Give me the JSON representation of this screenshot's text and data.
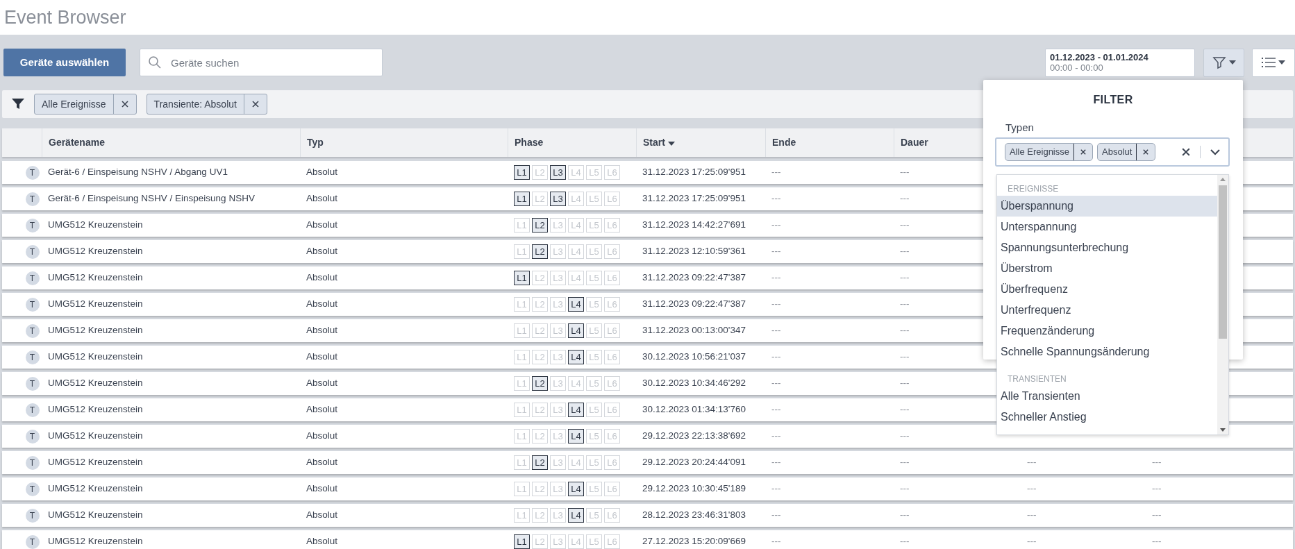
{
  "title": "Event Browser",
  "toolbar": {
    "select_button": "Geräte auswählen",
    "search": {
      "placeholder": "Geräte suchen"
    },
    "date_range": {
      "dates": "01.12.2023 - 01.01.2024",
      "times": "00:00 - 00:00"
    },
    "filter_open": true
  },
  "active_filters": [
    "Alle Ereignisse",
    "Transiente: Absolut"
  ],
  "table": {
    "columns": [
      {
        "label": "Gerätename",
        "sorted": false
      },
      {
        "label": "Typ",
        "sorted": false
      },
      {
        "label": "Phase",
        "sorted": false
      },
      {
        "label": "Start",
        "sorted": true
      },
      {
        "label": "Ende",
        "sorted": false
      },
      {
        "label": "Dauer",
        "sorted": false
      }
    ],
    "rows": [
      {
        "badge": "T",
        "name": "Gerät-6 / Einspeisung NSHV / Abgang UV1",
        "type": "Absolut",
        "phases": [
          {
            "label": "L1",
            "active": true
          },
          {
            "label": "L2",
            "active": false
          },
          {
            "label": "L3",
            "active": true
          },
          {
            "label": "L4",
            "active": false
          },
          {
            "label": "L5",
            "active": false
          },
          {
            "label": "L6",
            "active": false
          }
        ],
        "start": "31.12.2023 17:25:09'951",
        "end": "---",
        "duration": "---"
      },
      {
        "badge": "T",
        "name": "Gerät-6 / Einspeisung NSHV / Einspeisung NSHV",
        "type": "Absolut",
        "phases": [
          {
            "label": "L1",
            "active": true
          },
          {
            "label": "L2",
            "active": false
          },
          {
            "label": "L3",
            "active": true
          },
          {
            "label": "L4",
            "active": false
          },
          {
            "label": "L5",
            "active": false
          },
          {
            "label": "L6",
            "active": false
          }
        ],
        "start": "31.12.2023 17:25:09'951",
        "end": "---",
        "duration": "---"
      },
      {
        "badge": "T",
        "name": "UMG512 Kreuzenstein",
        "type": "Absolut",
        "phases": [
          {
            "label": "L1",
            "active": false
          },
          {
            "label": "L2",
            "active": true
          },
          {
            "label": "L3",
            "active": false
          },
          {
            "label": "L4",
            "active": false
          },
          {
            "label": "L5",
            "active": false
          },
          {
            "label": "L6",
            "active": false
          }
        ],
        "start": "31.12.2023 14:42:27'691",
        "end": "---",
        "duration": "---"
      },
      {
        "badge": "T",
        "name": "UMG512 Kreuzenstein",
        "type": "Absolut",
        "phases": [
          {
            "label": "L1",
            "active": false
          },
          {
            "label": "L2",
            "active": true
          },
          {
            "label": "L3",
            "active": false
          },
          {
            "label": "L4",
            "active": false
          },
          {
            "label": "L5",
            "active": false
          },
          {
            "label": "L6",
            "active": false
          }
        ],
        "start": "31.12.2023 12:10:59'361",
        "end": "---",
        "duration": "---"
      },
      {
        "badge": "T",
        "name": "UMG512 Kreuzenstein",
        "type": "Absolut",
        "phases": [
          {
            "label": "L1",
            "active": true
          },
          {
            "label": "L2",
            "active": false
          },
          {
            "label": "L3",
            "active": false
          },
          {
            "label": "L4",
            "active": false
          },
          {
            "label": "L5",
            "active": false
          },
          {
            "label": "L6",
            "active": false
          }
        ],
        "start": "31.12.2023 09:22:47'387",
        "end": "---",
        "duration": "---"
      },
      {
        "badge": "T",
        "name": "UMG512 Kreuzenstein",
        "type": "Absolut",
        "phases": [
          {
            "label": "L1",
            "active": false
          },
          {
            "label": "L2",
            "active": false
          },
          {
            "label": "L3",
            "active": false
          },
          {
            "label": "L4",
            "active": true
          },
          {
            "label": "L5",
            "active": false
          },
          {
            "label": "L6",
            "active": false
          }
        ],
        "start": "31.12.2023 09:22:47'387",
        "end": "---",
        "duration": "---"
      },
      {
        "badge": "T",
        "name": "UMG512 Kreuzenstein",
        "type": "Absolut",
        "phases": [
          {
            "label": "L1",
            "active": false
          },
          {
            "label": "L2",
            "active": false
          },
          {
            "label": "L3",
            "active": false
          },
          {
            "label": "L4",
            "active": true
          },
          {
            "label": "L5",
            "active": false
          },
          {
            "label": "L6",
            "active": false
          }
        ],
        "start": "31.12.2023 00:13:00'347",
        "end": "---",
        "duration": "---"
      },
      {
        "badge": "T",
        "name": "UMG512 Kreuzenstein",
        "type": "Absolut",
        "phases": [
          {
            "label": "L1",
            "active": false
          },
          {
            "label": "L2",
            "active": false
          },
          {
            "label": "L3",
            "active": false
          },
          {
            "label": "L4",
            "active": true
          },
          {
            "label": "L5",
            "active": false
          },
          {
            "label": "L6",
            "active": false
          }
        ],
        "start": "30.12.2023 10:56:21'037",
        "end": "---",
        "duration": "---"
      },
      {
        "badge": "T",
        "name": "UMG512 Kreuzenstein",
        "type": "Absolut",
        "phases": [
          {
            "label": "L1",
            "active": false
          },
          {
            "label": "L2",
            "active": true
          },
          {
            "label": "L3",
            "active": false
          },
          {
            "label": "L4",
            "active": false
          },
          {
            "label": "L5",
            "active": false
          },
          {
            "label": "L6",
            "active": false
          }
        ],
        "start": "30.12.2023 10:34:46'292",
        "end": "---",
        "duration": "---"
      },
      {
        "badge": "T",
        "name": "UMG512 Kreuzenstein",
        "type": "Absolut",
        "phases": [
          {
            "label": "L1",
            "active": false
          },
          {
            "label": "L2",
            "active": false
          },
          {
            "label": "L3",
            "active": false
          },
          {
            "label": "L4",
            "active": true
          },
          {
            "label": "L5",
            "active": false
          },
          {
            "label": "L6",
            "active": false
          }
        ],
        "start": "30.12.2023 01:34:13'760",
        "end": "---",
        "duration": "---"
      },
      {
        "badge": "T",
        "name": "UMG512 Kreuzenstein",
        "type": "Absolut",
        "phases": [
          {
            "label": "L1",
            "active": false
          },
          {
            "label": "L2",
            "active": false
          },
          {
            "label": "L3",
            "active": false
          },
          {
            "label": "L4",
            "active": true
          },
          {
            "label": "L5",
            "active": false
          },
          {
            "label": "L6",
            "active": false
          }
        ],
        "start": "29.12.2023 22:13:38'692",
        "end": "---",
        "duration": "---"
      },
      {
        "badge": "T",
        "name": "UMG512 Kreuzenstein",
        "type": "Absolut",
        "phases": [
          {
            "label": "L1",
            "active": false
          },
          {
            "label": "L2",
            "active": true
          },
          {
            "label": "L3",
            "active": false
          },
          {
            "label": "L4",
            "active": false
          },
          {
            "label": "L5",
            "active": false
          },
          {
            "label": "L6",
            "active": false
          }
        ],
        "start": "29.12.2023 20:24:44'091",
        "end": "---",
        "duration": "---",
        "column_7": "---",
        "column_8": "---"
      },
      {
        "badge": "T",
        "name": "UMG512 Kreuzenstein",
        "type": "Absolut",
        "phases": [
          {
            "label": "L1",
            "active": false
          },
          {
            "label": "L2",
            "active": false
          },
          {
            "label": "L3",
            "active": false
          },
          {
            "label": "L4",
            "active": true
          },
          {
            "label": "L5",
            "active": false
          },
          {
            "label": "L6",
            "active": false
          }
        ],
        "start": "29.12.2023 10:30:45'189",
        "end": "---",
        "duration": "---",
        "column_7": "---",
        "column_8": "---"
      },
      {
        "badge": "T",
        "name": "UMG512 Kreuzenstein",
        "type": "Absolut",
        "phases": [
          {
            "label": "L1",
            "active": false
          },
          {
            "label": "L2",
            "active": false
          },
          {
            "label": "L3",
            "active": false
          },
          {
            "label": "L4",
            "active": true
          },
          {
            "label": "L5",
            "active": false
          },
          {
            "label": "L6",
            "active": false
          }
        ],
        "start": "28.12.2023 23:46:31'803",
        "end": "---",
        "duration": "---",
        "column_7": "---",
        "column_8": "---"
      },
      {
        "badge": "T",
        "name": "UMG512 Kreuzenstein",
        "type": "Absolut",
        "phases": [
          {
            "label": "L1",
            "active": true
          },
          {
            "label": "L2",
            "active": false
          },
          {
            "label": "L3",
            "active": false
          },
          {
            "label": "L4",
            "active": false
          },
          {
            "label": "L5",
            "active": false
          },
          {
            "label": "L6",
            "active": false
          }
        ],
        "start": "27.12.2023 15:20:09'669",
        "end": "---",
        "duration": "---",
        "column_7": "---",
        "column_8": "---"
      }
    ]
  },
  "filter_panel": {
    "title": "FILTER",
    "label": "Typen",
    "chips": [
      "Alle Ereignisse",
      "Absolut"
    ],
    "groups": [
      {
        "heading": "EREIGNISSE",
        "items": [
          {
            "label": "Überspannung",
            "highlighted": true
          },
          {
            "label": "Unterspannung",
            "highlighted": false
          },
          {
            "label": "Spannungsunterbrechung",
            "highlighted": false
          },
          {
            "label": "Überstrom",
            "highlighted": false
          },
          {
            "label": "Überfrequenz",
            "highlighted": false
          },
          {
            "label": "Unterfrequenz",
            "highlighted": false
          },
          {
            "label": "Frequenzänderung",
            "highlighted": false
          },
          {
            "label": "Schnelle Spannungsänderung",
            "highlighted": false
          }
        ]
      },
      {
        "heading": "TRANSIENTEN",
        "items": [
          {
            "label": "Alle Transienten",
            "highlighted": false
          },
          {
            "label": "Schneller Anstieg",
            "highlighted": false
          }
        ]
      }
    ]
  }
}
